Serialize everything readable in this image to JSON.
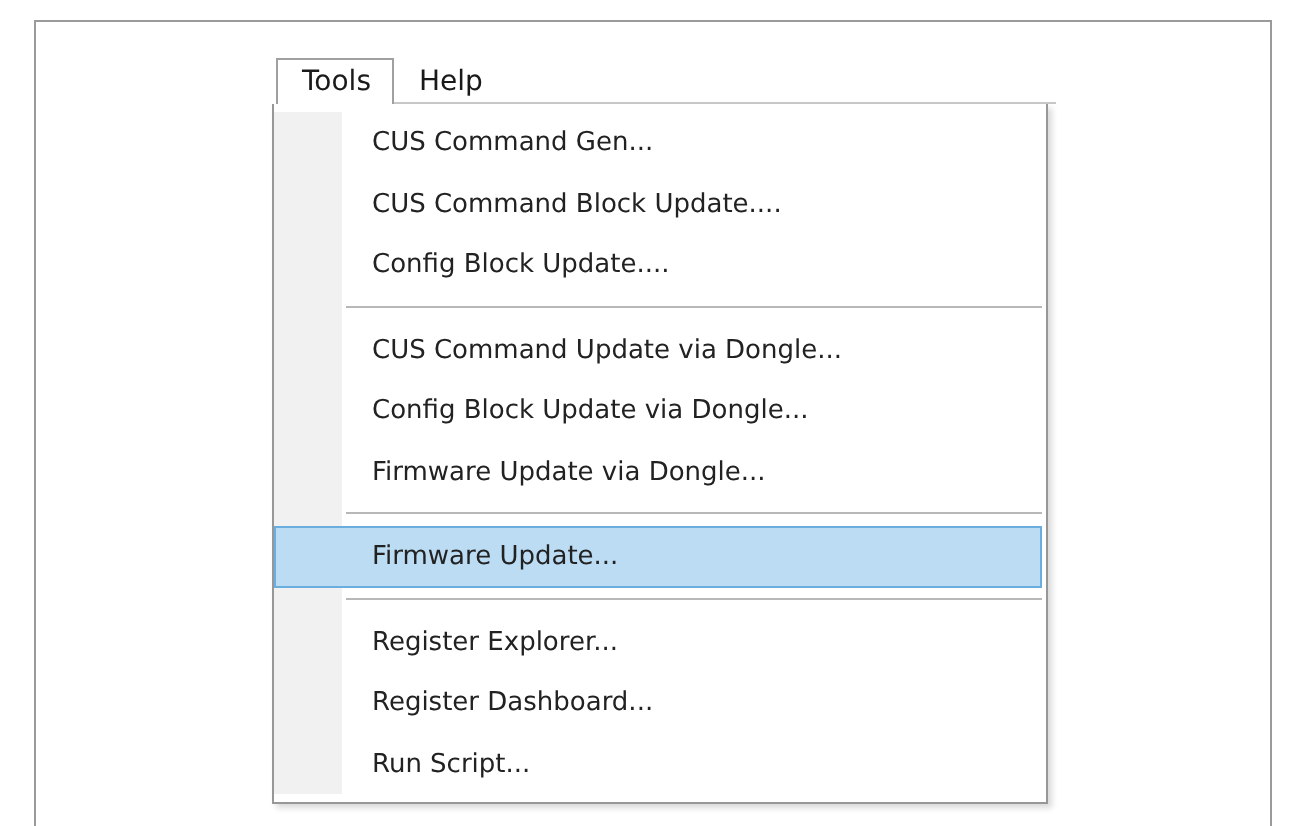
{
  "menu_bar": [
    {
      "label": "Tools",
      "selected": true
    },
    {
      "label": "Help",
      "selected": false
    }
  ],
  "menu": {
    "items": [
      {
        "kind": "item",
        "label": "CUS Command Gen...",
        "selected": false
      },
      {
        "kind": "item",
        "label": "CUS Command Block Update....",
        "selected": false
      },
      {
        "kind": "item",
        "label": "Config Block Update....",
        "selected": false
      },
      {
        "kind": "separator"
      },
      {
        "kind": "item",
        "label": "CUS Command Update via Dongle...",
        "selected": false
      },
      {
        "kind": "item",
        "label": "Config Block Update via Dongle...",
        "selected": false
      },
      {
        "kind": "item",
        "label": "Firmware Update via Dongle...",
        "selected": false
      },
      {
        "kind": "separator"
      },
      {
        "kind": "item",
        "label": "Firmware Update...",
        "selected": true
      },
      {
        "kind": "separator"
      },
      {
        "kind": "item",
        "label": "Register Explorer...",
        "selected": false
      },
      {
        "kind": "item",
        "label": "Register Dashboard...",
        "selected": false
      },
      {
        "kind": "item",
        "label": "Run Script...",
        "selected": false
      }
    ]
  }
}
